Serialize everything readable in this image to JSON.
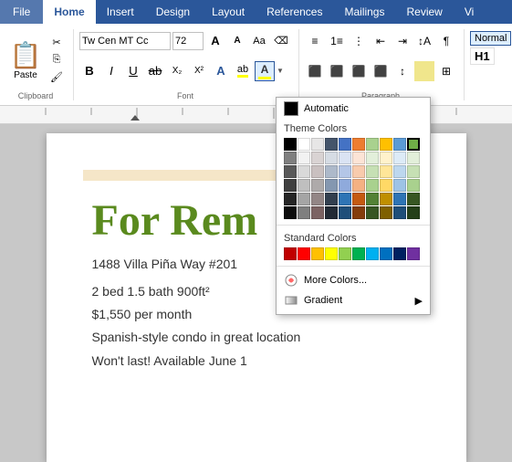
{
  "tabs": {
    "items": [
      {
        "label": "File",
        "id": "file",
        "active": false
      },
      {
        "label": "Home",
        "id": "home",
        "active": true
      },
      {
        "label": "Insert",
        "id": "insert",
        "active": false
      },
      {
        "label": "Design",
        "id": "design",
        "active": false
      },
      {
        "label": "Layout",
        "id": "layout",
        "active": false
      },
      {
        "label": "References",
        "id": "references",
        "active": false
      },
      {
        "label": "Mailings",
        "id": "mailings",
        "active": false
      },
      {
        "label": "Review",
        "id": "review",
        "active": false
      },
      {
        "label": "Vi",
        "id": "view",
        "active": false
      }
    ]
  },
  "ribbon": {
    "font_name": "Tw Cen MT Cc",
    "font_size": "72",
    "groups": {
      "clipboard_label": "Clipboard",
      "font_label": "Font"
    }
  },
  "color_picker": {
    "auto_label": "Automatic",
    "theme_colors_label": "Theme Colors",
    "standard_colors_label": "Standard Colors",
    "more_colors_label": "More Colors...",
    "gradient_label": "Gradient",
    "theme_colors_row1": [
      "#000000",
      "#ffffff",
      "#e7e6e6",
      "#44546a",
      "#4472c4",
      "#ed7d31",
      "#a9d18e",
      "#ffc000",
      "#5b9bd5",
      "#70ad47"
    ],
    "theme_colors_rows": [
      [
        "#7f7f7f",
        "#f2f2f2",
        "#d9d3d3",
        "#d6dce4",
        "#dae3f3",
        "#fce4d6",
        "#e2efda",
        "#fff2cc",
        "#ddebf7",
        "#e2efda"
      ],
      [
        "#595959",
        "#d9d9d9",
        "#c9c0c0",
        "#adb9ca",
        "#b4c6e7",
        "#f8cbad",
        "#c6e0b4",
        "#ffe699",
        "#bdd7ee",
        "#c6e0b4"
      ],
      [
        "#404040",
        "#bfbfbf",
        "#aeaaaa",
        "#8497b0",
        "#8faadc",
        "#f4b183",
        "#a9d18e",
        "#ffd966",
        "#9dc3e6",
        "#a9d18e"
      ],
      [
        "#262626",
        "#a5a5a5",
        "#938686",
        "#323f4f",
        "#2e74b5",
        "#c55a11",
        "#538135",
        "#bf8f00",
        "#2e74b5",
        "#375623"
      ],
      [
        "#0d0d0d",
        "#7f7f7f",
        "#7c6363",
        "#222a35",
        "#1f4e79",
        "#843c0c",
        "#375623",
        "#7f6000",
        "#1f4e79",
        "#243f18"
      ]
    ],
    "standard_colors": [
      "#c00000",
      "#ff0000",
      "#ffc000",
      "#ffff00",
      "#92d050",
      "#00b050",
      "#00b0f0",
      "#0070c0",
      "#002060",
      "#7030a0"
    ],
    "selected_color": "#70ad47"
  },
  "document": {
    "title": "For Rem",
    "address": "1488 Villa Piña Way #201",
    "bed_bath": "2 bed 1.5 bath 900ft²",
    "price": "$1,550 per month",
    "description": "Spanish-style condo in great location",
    "cta": "Won't last! Available June 1"
  }
}
